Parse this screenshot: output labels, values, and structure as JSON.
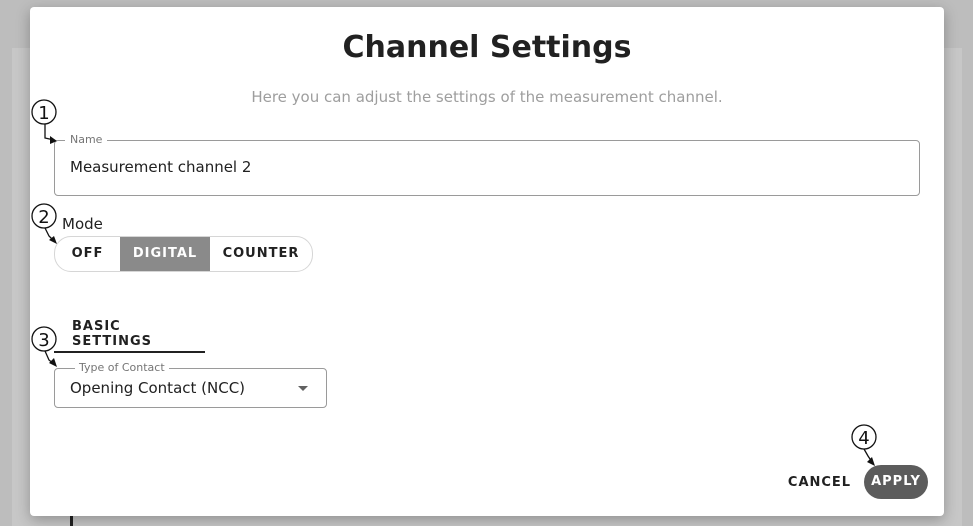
{
  "dialog": {
    "title": "Channel Settings",
    "subtitle": "Here you can adjust the settings of the measurement channel."
  },
  "name_field": {
    "label": "Name",
    "value": "Measurement channel 2"
  },
  "mode": {
    "label": "Mode",
    "options": [
      "OFF",
      "DIGITAL",
      "COUNTER"
    ],
    "selected": "DIGITAL"
  },
  "tabs": [
    {
      "label": "BASIC SETTINGS",
      "active": true
    }
  ],
  "contact_select": {
    "label": "Type of Contact",
    "value": "Opening Contact (NCC)"
  },
  "actions": {
    "cancel_label": "CANCEL",
    "apply_label": "APPLY"
  },
  "callouts": [
    "1",
    "2",
    "3",
    "4"
  ],
  "icons": {
    "dropdown": "chevron-down-icon"
  },
  "colors": {
    "selected_mode_bg": "#8a8a8a",
    "apply_bg": "#5c5c5c",
    "subtitle": "#9e9e9e"
  }
}
